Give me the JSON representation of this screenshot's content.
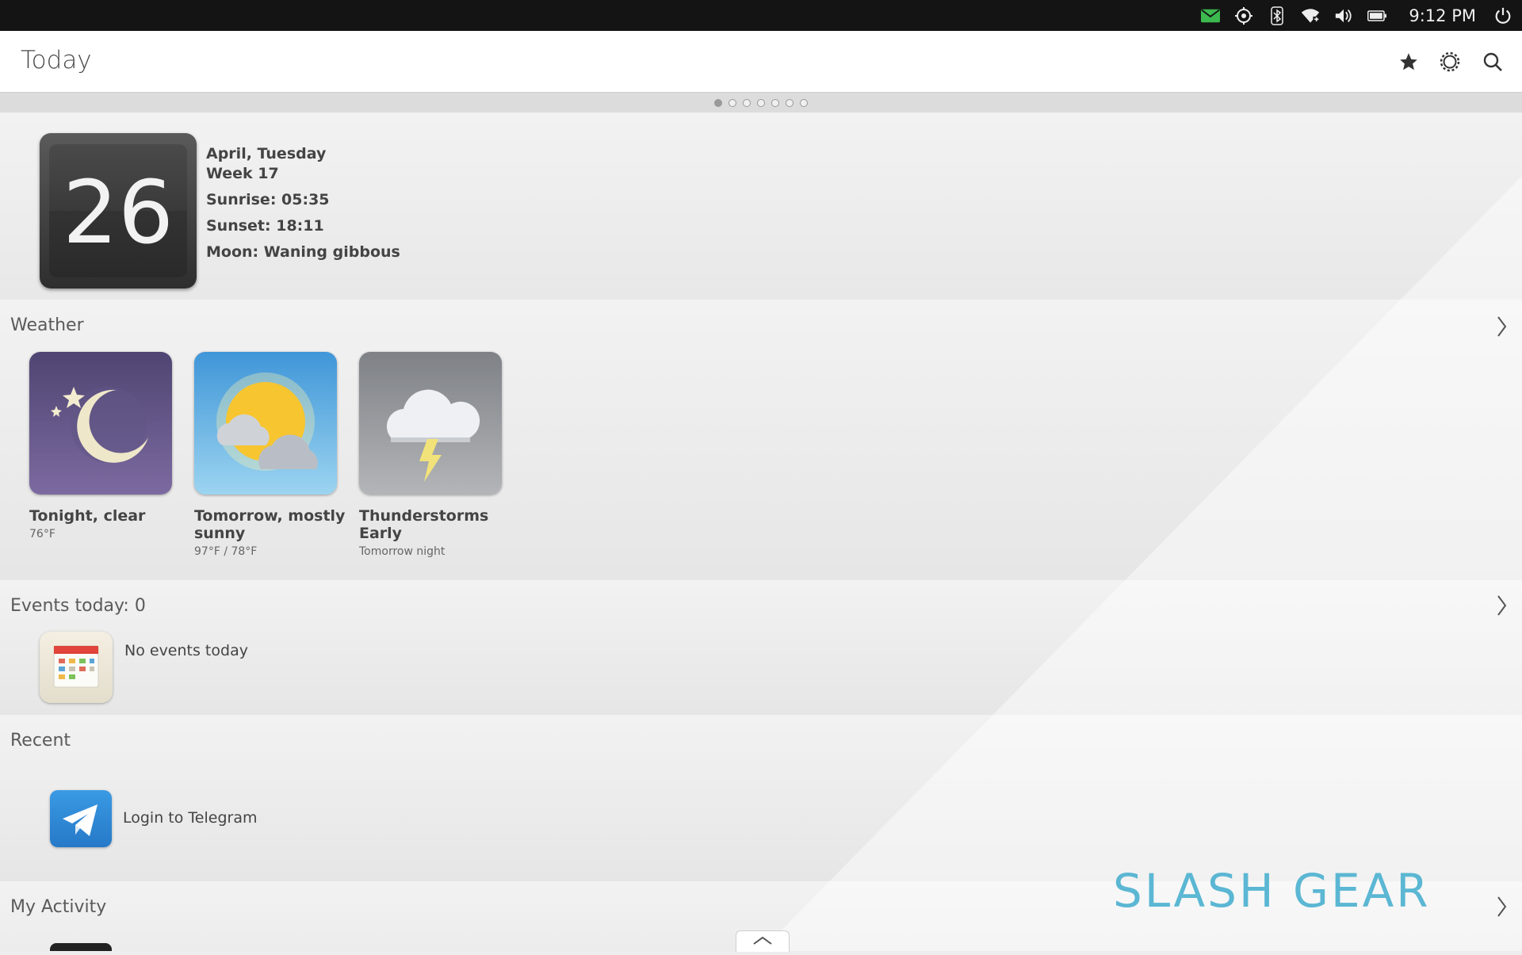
{
  "status_bar": {
    "icons": [
      "mail-icon",
      "location-icon",
      "bluetooth-icon",
      "wifi-icon",
      "volume-icon",
      "battery-icon",
      "power-icon"
    ],
    "time": "9:12 PM",
    "mail_color": "#3cb94f"
  },
  "header": {
    "title": "Today",
    "actions": [
      "star-icon",
      "settings-icon",
      "search-icon"
    ]
  },
  "page_dots": {
    "count": 7,
    "active_index": 0
  },
  "date_card": {
    "day": "26",
    "line1": "April, Tuesday",
    "line2": "Week 17",
    "sunrise": "Sunrise: 05:35",
    "sunset": "Sunset: 18:11",
    "moon": "Moon: Waning gibbous"
  },
  "weather": {
    "title": "Weather",
    "items": [
      {
        "label": "Tonight, clear",
        "detail": "76°F"
      },
      {
        "label": "Tomorrow, mostly sunny",
        "detail": "97°F / 78°F"
      },
      {
        "label": "Thunderstorms Early",
        "detail": "Tomorrow night"
      }
    ]
  },
  "events": {
    "title": "Events today: 0",
    "message": "No events today"
  },
  "recent": {
    "title": "Recent",
    "item_label": "Login to Telegram"
  },
  "activity": {
    "title": "My Activity"
  },
  "watermark": "SLASH GEAR",
  "colors": {
    "accent_blue": "#2f8fdc",
    "statusbar_bg": "#141414",
    "watermark": "#5bb7d3"
  }
}
